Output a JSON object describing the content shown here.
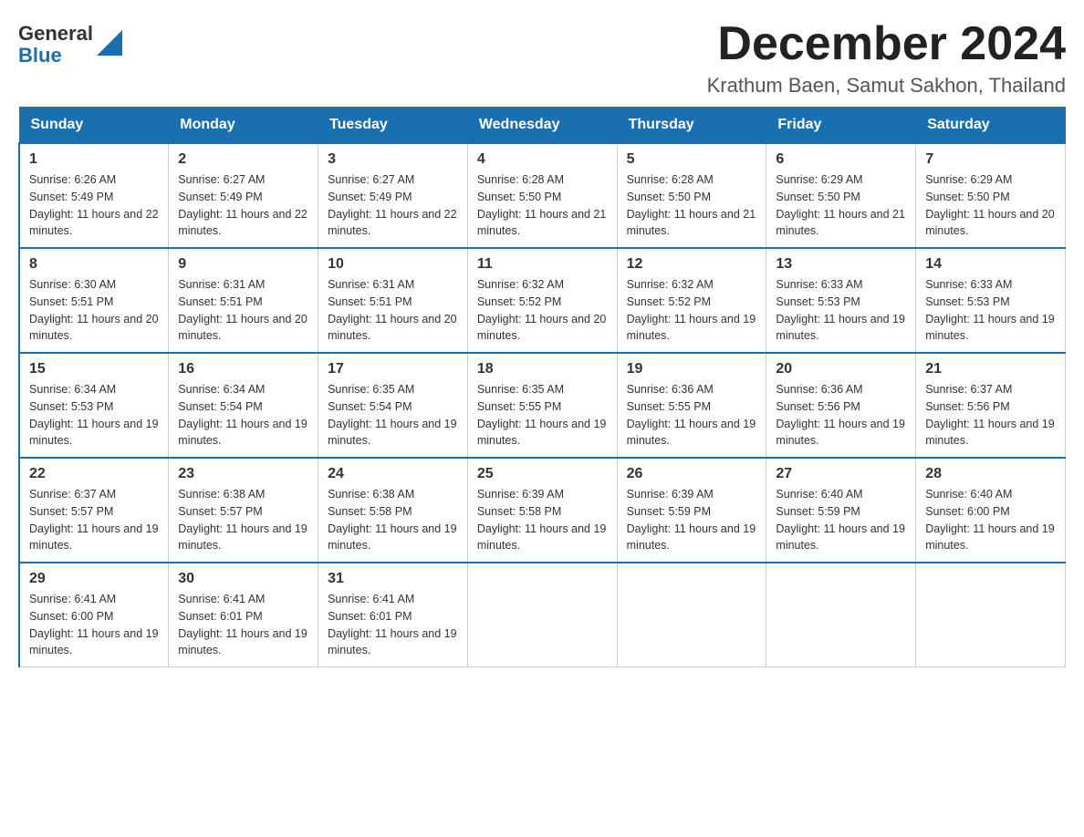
{
  "header": {
    "logo_general": "General",
    "logo_blue": "Blue",
    "month_title": "December 2024",
    "subtitle": "Krathum Baen, Samut Sakhon, Thailand"
  },
  "weekdays": [
    "Sunday",
    "Monday",
    "Tuesday",
    "Wednesday",
    "Thursday",
    "Friday",
    "Saturday"
  ],
  "weeks": [
    [
      {
        "day": "1",
        "sunrise": "6:26 AM",
        "sunset": "5:49 PM",
        "daylight": "11 hours and 22 minutes."
      },
      {
        "day": "2",
        "sunrise": "6:27 AM",
        "sunset": "5:49 PM",
        "daylight": "11 hours and 22 minutes."
      },
      {
        "day": "3",
        "sunrise": "6:27 AM",
        "sunset": "5:49 PM",
        "daylight": "11 hours and 22 minutes."
      },
      {
        "day": "4",
        "sunrise": "6:28 AM",
        "sunset": "5:50 PM",
        "daylight": "11 hours and 21 minutes."
      },
      {
        "day": "5",
        "sunrise": "6:28 AM",
        "sunset": "5:50 PM",
        "daylight": "11 hours and 21 minutes."
      },
      {
        "day": "6",
        "sunrise": "6:29 AM",
        "sunset": "5:50 PM",
        "daylight": "11 hours and 21 minutes."
      },
      {
        "day": "7",
        "sunrise": "6:29 AM",
        "sunset": "5:50 PM",
        "daylight": "11 hours and 20 minutes."
      }
    ],
    [
      {
        "day": "8",
        "sunrise": "6:30 AM",
        "sunset": "5:51 PM",
        "daylight": "11 hours and 20 minutes."
      },
      {
        "day": "9",
        "sunrise": "6:31 AM",
        "sunset": "5:51 PM",
        "daylight": "11 hours and 20 minutes."
      },
      {
        "day": "10",
        "sunrise": "6:31 AM",
        "sunset": "5:51 PM",
        "daylight": "11 hours and 20 minutes."
      },
      {
        "day": "11",
        "sunrise": "6:32 AM",
        "sunset": "5:52 PM",
        "daylight": "11 hours and 20 minutes."
      },
      {
        "day": "12",
        "sunrise": "6:32 AM",
        "sunset": "5:52 PM",
        "daylight": "11 hours and 19 minutes."
      },
      {
        "day": "13",
        "sunrise": "6:33 AM",
        "sunset": "5:53 PM",
        "daylight": "11 hours and 19 minutes."
      },
      {
        "day": "14",
        "sunrise": "6:33 AM",
        "sunset": "5:53 PM",
        "daylight": "11 hours and 19 minutes."
      }
    ],
    [
      {
        "day": "15",
        "sunrise": "6:34 AM",
        "sunset": "5:53 PM",
        "daylight": "11 hours and 19 minutes."
      },
      {
        "day": "16",
        "sunrise": "6:34 AM",
        "sunset": "5:54 PM",
        "daylight": "11 hours and 19 minutes."
      },
      {
        "day": "17",
        "sunrise": "6:35 AM",
        "sunset": "5:54 PM",
        "daylight": "11 hours and 19 minutes."
      },
      {
        "day": "18",
        "sunrise": "6:35 AM",
        "sunset": "5:55 PM",
        "daylight": "11 hours and 19 minutes."
      },
      {
        "day": "19",
        "sunrise": "6:36 AM",
        "sunset": "5:55 PM",
        "daylight": "11 hours and 19 minutes."
      },
      {
        "day": "20",
        "sunrise": "6:36 AM",
        "sunset": "5:56 PM",
        "daylight": "11 hours and 19 minutes."
      },
      {
        "day": "21",
        "sunrise": "6:37 AM",
        "sunset": "5:56 PM",
        "daylight": "11 hours and 19 minutes."
      }
    ],
    [
      {
        "day": "22",
        "sunrise": "6:37 AM",
        "sunset": "5:57 PM",
        "daylight": "11 hours and 19 minutes."
      },
      {
        "day": "23",
        "sunrise": "6:38 AM",
        "sunset": "5:57 PM",
        "daylight": "11 hours and 19 minutes."
      },
      {
        "day": "24",
        "sunrise": "6:38 AM",
        "sunset": "5:58 PM",
        "daylight": "11 hours and 19 minutes."
      },
      {
        "day": "25",
        "sunrise": "6:39 AM",
        "sunset": "5:58 PM",
        "daylight": "11 hours and 19 minutes."
      },
      {
        "day": "26",
        "sunrise": "6:39 AM",
        "sunset": "5:59 PM",
        "daylight": "11 hours and 19 minutes."
      },
      {
        "day": "27",
        "sunrise": "6:40 AM",
        "sunset": "5:59 PM",
        "daylight": "11 hours and 19 minutes."
      },
      {
        "day": "28",
        "sunrise": "6:40 AM",
        "sunset": "6:00 PM",
        "daylight": "11 hours and 19 minutes."
      }
    ],
    [
      {
        "day": "29",
        "sunrise": "6:41 AM",
        "sunset": "6:00 PM",
        "daylight": "11 hours and 19 minutes."
      },
      {
        "day": "30",
        "sunrise": "6:41 AM",
        "sunset": "6:01 PM",
        "daylight": "11 hours and 19 minutes."
      },
      {
        "day": "31",
        "sunrise": "6:41 AM",
        "sunset": "6:01 PM",
        "daylight": "11 hours and 19 minutes."
      },
      null,
      null,
      null,
      null
    ]
  ],
  "labels": {
    "sunrise": "Sunrise: ",
    "sunset": "Sunset: ",
    "daylight": "Daylight: "
  }
}
